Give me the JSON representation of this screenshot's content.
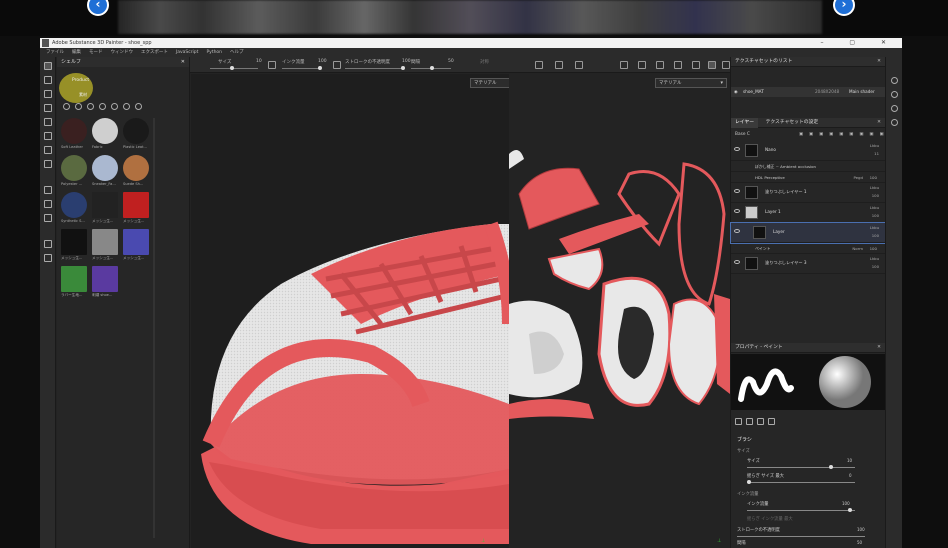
{
  "carousel": {
    "prev_label": "‹",
    "next_label": "›"
  },
  "app": {
    "title": "Adobe Substance 3D Painter - shoe_spp"
  },
  "window_controls": [
    "–",
    "▢",
    "✕"
  ],
  "menu": [
    "ファイル",
    "編集",
    "モード",
    "ウィンドウ",
    "エクスポート",
    "JavaScript",
    "Python",
    "ヘルプ"
  ],
  "toolbar": {
    "size_label": "サイズ",
    "size_value": "10",
    "flow_label": "インク流量",
    "flow_value": "100",
    "stroke_label": "ストロークの不透明度",
    "stroke_value": "100",
    "spacing_label": "間隔",
    "spacing_value": "50",
    "symmetry_label": "対称"
  },
  "shelf": {
    "title": "シェルフ",
    "breadcrumb": "Product",
    "crumb_sub": "素材",
    "assets": [
      {
        "label": "Soft Leather",
        "color": "#3a2020"
      },
      {
        "label": "Fabric",
        "color": "#cfcfcf"
      },
      {
        "label": "Plastic Leat...",
        "color": "#1a1a1a"
      },
      {
        "label": "Polyester ...",
        "color": "#5a6a40"
      },
      {
        "label": "Sneaker_Fa...",
        "color": "#aab8d0"
      },
      {
        "label": "Suede Sh...",
        "color": "#b07040"
      },
      {
        "label": "Synthetic S...",
        "color": "#2a3e70"
      },
      {
        "label": "メッシュ生...",
        "color": "#222"
      },
      {
        "label": "メッシュ生...",
        "color": "#c02020"
      },
      {
        "label": "メッシュ生...",
        "color": "#111"
      },
      {
        "label": "メッシュ生...",
        "color": "#888"
      },
      {
        "label": "メッシュ生...",
        "color": "#4a4ab0"
      },
      {
        "label": "ラバー生地...",
        "color": "#3a8a3a"
      },
      {
        "label": "刺繍 shoe...",
        "color": "#5a3aa0"
      }
    ]
  },
  "viewport3d": {
    "mode": "マテリアル"
  },
  "viewport2d": {
    "mode": "マテリアル"
  },
  "texture_set_list": {
    "title": "テクスチャセットのリスト",
    "set_name": "shoe_MAT",
    "resolution": "2048X2048",
    "shader": "Main shader"
  },
  "layers": {
    "tab_layers": "レイヤー",
    "tab_settings": "テクスチャセットの設定",
    "blend_mode_label": "Base C",
    "items": [
      {
        "name": "Nano",
        "blend": "Lkbu",
        "value": "11",
        "thumb": "#111"
      },
      {
        "name": "ぼかし補正 ~ Ambient occlusion",
        "sub": true
      },
      {
        "name": "HDL Perceptive",
        "sub": true,
        "blend": "Pegd",
        "value": "100"
      },
      {
        "name": "塗りつぶしレイヤー 1",
        "blend": "Lkbu",
        "value": "100",
        "thumb": "#111"
      },
      {
        "name": "Layer 1",
        "blend": "Lkbu",
        "value": "100",
        "thumb": "#ccc"
      },
      {
        "name": "Layer",
        "blend": "Lkbu",
        "value": "100",
        "thumb": "#111",
        "selected": true
      },
      {
        "name": "ペイント",
        "sub": true,
        "blend": "Norm",
        "value": "100"
      },
      {
        "name": "塗りつぶしレイヤー 3",
        "blend": "Lkbu",
        "value": "100",
        "thumb": "#111"
      }
    ]
  },
  "properties": {
    "title": "プロパティ - ペイント",
    "section_brush": "ブラシ",
    "size_group": "サイズ",
    "size_label": "サイズ",
    "size_value": "10",
    "size_jitter_label": "揺らぎ サイズ 最大",
    "size_jitter_value": "0",
    "flow_group": "インク流量",
    "flow_label": "インク流量",
    "flow_value": "100",
    "flow_jitter_label": "揺らぎ インク流量 最大",
    "stroke_opacity_label": "ストロークの不透明度",
    "stroke_opacity_value": "100",
    "spacing_label": "間隔",
    "spacing_value": "50",
    "size_fill": 0.78,
    "flow_fill": 0.95
  },
  "colors": {
    "shoe_red": "#e4595c",
    "shoe_white": "#e8e8e8",
    "accent_blue": "#4a6fb0"
  }
}
